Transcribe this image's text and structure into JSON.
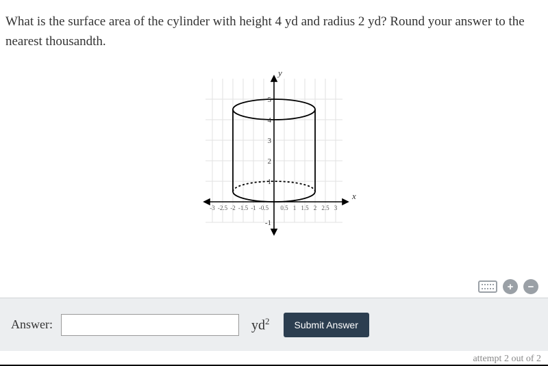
{
  "question": "What is the surface area of the cylinder with height 4 yd and radius 2 yd? Round your answer to the nearest thousandth.",
  "graph": {
    "x_axis_label": "x",
    "y_axis_label": "y",
    "x_ticks": [
      "-3",
      "-2.5",
      "-2",
      "-1.5",
      "-1",
      "-0.5",
      "0.5",
      "1",
      "1.5",
      "2",
      "2.5",
      "3"
    ],
    "y_ticks": [
      "-1",
      "1",
      "2",
      "3",
      "4",
      "5"
    ],
    "cylinder": {
      "radius": 2,
      "height": 4,
      "base_y": 0.5,
      "top_y": 4.5
    }
  },
  "answer": {
    "label": "Answer:",
    "value": "",
    "placeholder": "",
    "unit_base": "yd",
    "unit_exp": "2",
    "submit_label": "Submit Answer"
  },
  "icons": {
    "keyboard": "keyboard-icon",
    "plus": "+",
    "minus": "−"
  },
  "attempt_text": "attempt 2 out of 2"
}
